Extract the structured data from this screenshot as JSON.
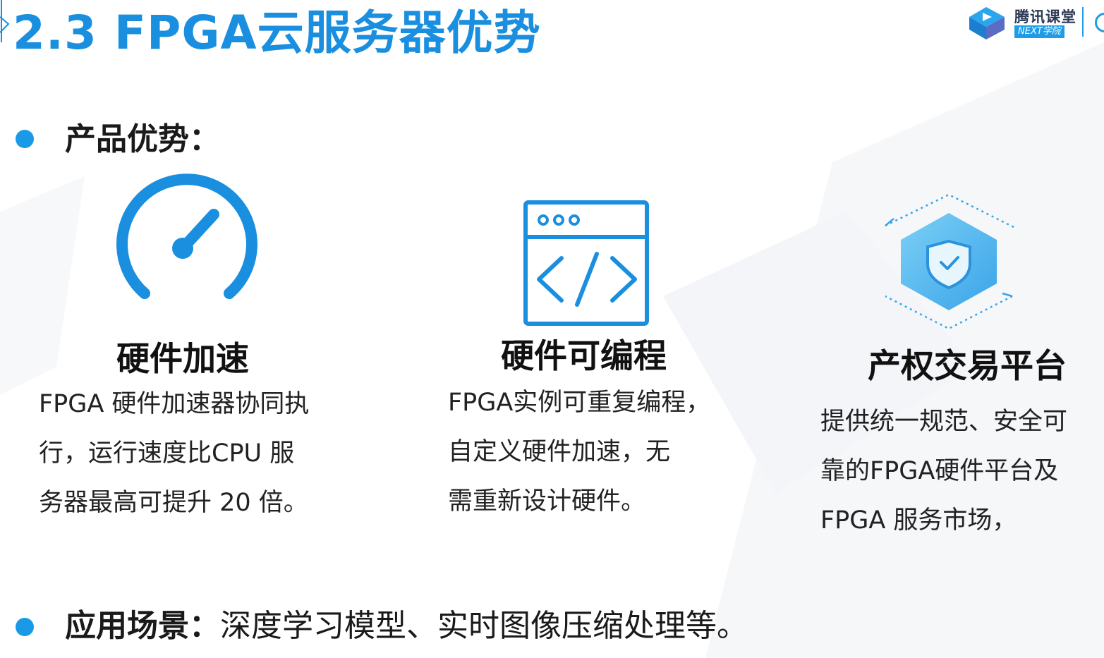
{
  "slide": {
    "title": "2.3 FPGA云服务器优势"
  },
  "logo": {
    "name": "腾讯课堂",
    "sub": "NEXT学院"
  },
  "advantages": {
    "heading": "产品优势：",
    "items": [
      {
        "title": "硬件加速",
        "icon": "speedometer-icon",
        "lines": [
          "FPGA 硬件加速器协同执",
          "行，运行速度比CPU 服",
          "务器最高可提升 20 倍。"
        ]
      },
      {
        "title": "硬件可编程",
        "icon": "code-window-icon",
        "lines": [
          "FPGA实例可重复编程，",
          "自定义硬件加速，无",
          "需重新设计硬件。"
        ]
      },
      {
        "title": "产权交易平台",
        "icon": "shield-check-icon",
        "lines": [
          "提供统一规范、安全可",
          "靠的FPGA硬件平台及",
          "FPGA 服务市场，"
        ]
      }
    ]
  },
  "scenarios": {
    "label": "应用场景：",
    "text": "深度学习模型、实时图像压缩处理等。"
  },
  "colors": {
    "accent": "#1a8fdf",
    "bullet": "#1a9ae6",
    "text": "#1a1a1a"
  }
}
